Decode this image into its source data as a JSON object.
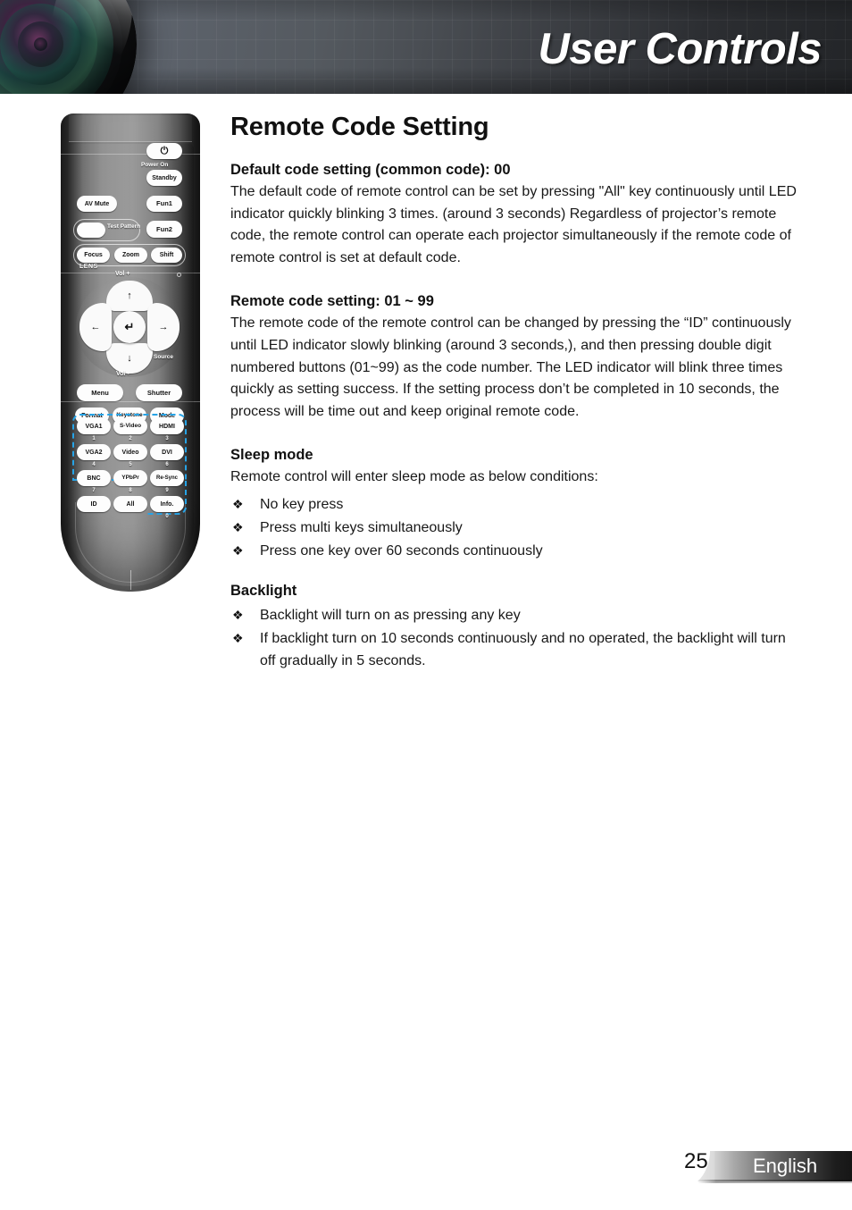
{
  "header": {
    "title": "User Controls",
    "lens_icon": "camera-lens-graphic"
  },
  "content": {
    "page_title": "Remote Code Setting",
    "sections": [
      {
        "heading": "Default code setting (common code): 00",
        "body": "The default code of remote control can be set by pressing \"All\" key continuously until LED indicator quickly blinking 3 times. (around 3 seconds) Regardless of projector’s remote code, the remote control can operate each projector simultaneously if the remote code of remote control is set at default code."
      },
      {
        "heading": "Remote code setting: 01 ~ 99",
        "body": "The remote code of the remote control can be changed by pressing the “ID” continuously until LED indicator slowly blinking (around 3 seconds,), and then pressing double digit numbered buttons (01~99) as the code number. The LED indicator will blink three times quickly as setting success.  If  the setting process don’t be completed in 10 seconds, the process will be time out and keep original remote code."
      },
      {
        "heading": "Sleep mode",
        "body": "Remote control will enter sleep mode as below conditions:",
        "bullets": [
          "No key press",
          "Press multi keys simultaneously",
          "Press one key over 60 seconds continuously"
        ]
      },
      {
        "heading": "Backlight",
        "body": "",
        "bullets": [
          "Backlight will turn on as pressing any key",
          "If backlight turn on 10 seconds continuously and no operated, the backlight will turn off gradually in 5 seconds."
        ]
      }
    ],
    "bullet_symbol": "❖"
  },
  "remote": {
    "power_icon": "power-symbol",
    "power_label": "Power  On",
    "buttons": {
      "standby": "Standby",
      "av_mute": "AV Mute",
      "fun1": "Fun1",
      "fun2": "Fun2",
      "test_pattern": "Test Pattern",
      "focus": "Focus",
      "zoom": "Zoom",
      "shift": "Shift",
      "lens_group": "LENS",
      "menu": "Menu",
      "shutter": "Shutter",
      "format": "Format",
      "keystone": "Keystone",
      "mode": "Mode",
      "id": "ID",
      "all": "All",
      "info": "Info."
    },
    "dpad": {
      "vol_up": "Vol +",
      "vol_down": "Vol -",
      "source": "Source",
      "up": "↑",
      "down": "↓",
      "left": "←",
      "right": "→",
      "enter": "↵"
    },
    "keypad": [
      {
        "label": "VGA1",
        "number": "1"
      },
      {
        "label": "S-Video",
        "number": "2"
      },
      {
        "label": "HDMI",
        "number": "3"
      },
      {
        "label": "VGA2",
        "number": "4"
      },
      {
        "label": "Video",
        "number": "5"
      },
      {
        "label": "DVI",
        "number": "6"
      },
      {
        "label": "BNC",
        "number": "7"
      },
      {
        "label": "YPbPr",
        "number": "8"
      },
      {
        "label": "Re-Sync",
        "number": "9"
      }
    ],
    "info_number": "0",
    "highlight_color": "#27a3e6"
  },
  "footer": {
    "page_number": "25",
    "language": "English"
  }
}
